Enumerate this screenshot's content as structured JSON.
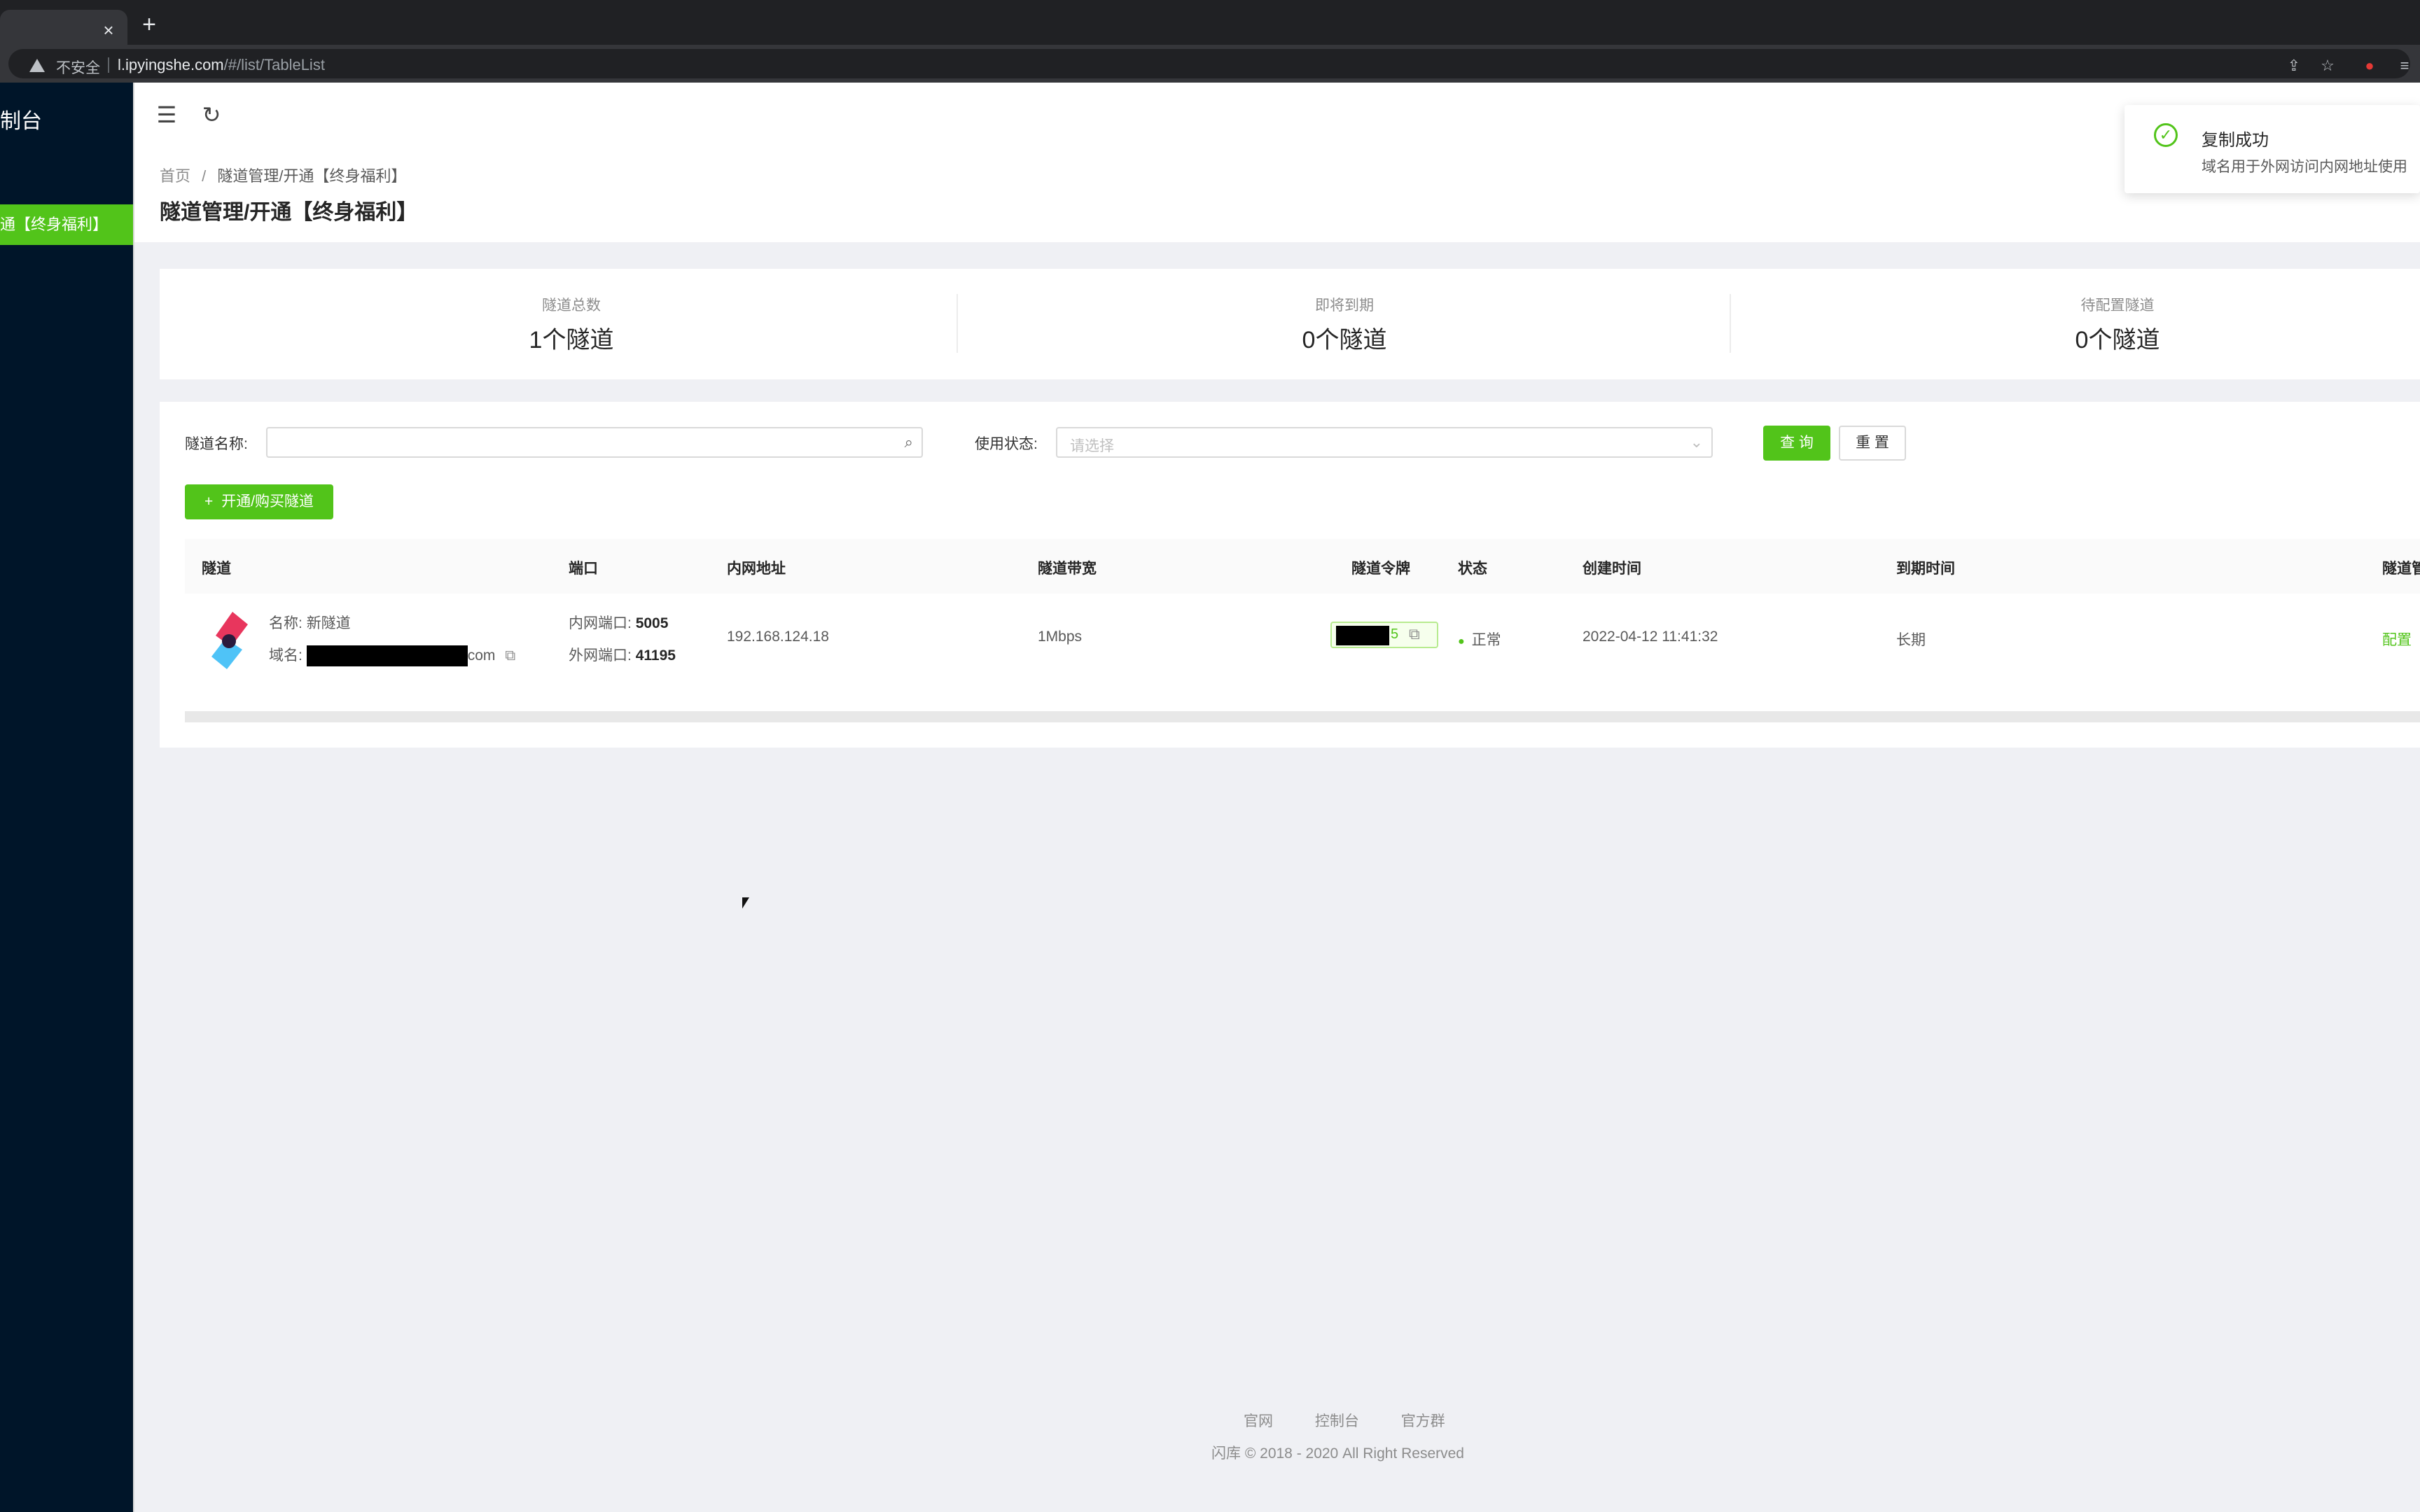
{
  "browser": {
    "tab_close": "×",
    "new_tab": "+",
    "insecure_label": "不安全",
    "url_host": "l.ipyingshe.com",
    "url_path": "/#/list/TableList"
  },
  "sidebar": {
    "logo_text": "制台",
    "active_item": "通【终身福利】"
  },
  "breadcrumb": {
    "home": "首页",
    "separator": "/",
    "current": "隧道管理/开通【终身福利】"
  },
  "page_title": "隧道管理/开通【终身福利】",
  "stats": [
    {
      "label": "隧道总数",
      "value": "1个隧道"
    },
    {
      "label": "即将到期",
      "value": "0个隧道"
    },
    {
      "label": "待配置隧道",
      "value": "0个隧道"
    }
  ],
  "filters": {
    "name_label": "隧道名称:",
    "name_value": "",
    "status_label": "使用状态:",
    "status_placeholder": "请选择",
    "query_button": "查 询",
    "reset_button": "重 置",
    "add_button": "开通/购买隧道"
  },
  "table": {
    "columns": [
      "隧道",
      "端口",
      "内网地址",
      "隧道带宽",
      "隧道令牌",
      "状态",
      "创建时间",
      "到期时间",
      "隧道管"
    ],
    "rows": [
      {
        "name_label": "名称:",
        "name": "新隧道",
        "domain_label": "域名:",
        "domain_suffix": "com",
        "inner_port_label": "内网端口:",
        "inner_port": "5005",
        "outer_port_label": "外网端口:",
        "outer_port": "41195",
        "address": "192.168.124.18",
        "bandwidth": "1Mbps",
        "token_tail": "5",
        "status": "正常",
        "created": "2022-04-12 11:41:32",
        "expires": "长期",
        "action": "配置"
      }
    ]
  },
  "footer": {
    "links": [
      "官网",
      "控制台",
      "官方群"
    ],
    "copyright": "闪库 © 2018 - 2020 All Right Reserved"
  },
  "notification": {
    "title": "复制成功",
    "description": "域名用于外网访问内网地址使用"
  },
  "colors": {
    "primary": "#52c41a",
    "sidebar": "#001529"
  }
}
